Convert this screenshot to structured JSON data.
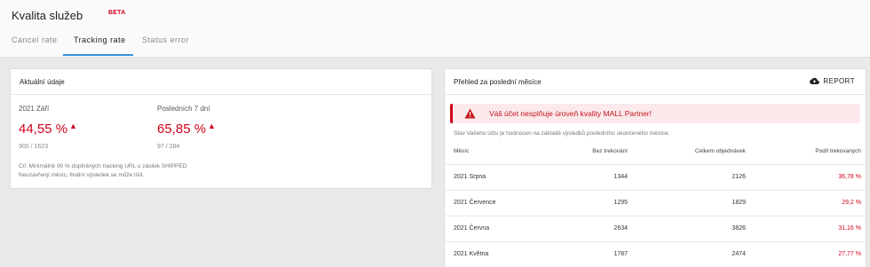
{
  "header": {
    "title": "Kvalita služeb",
    "badge": "BETA",
    "tabs": [
      {
        "label": "Cancel rate"
      },
      {
        "label": "Tracking rate"
      },
      {
        "label": "Status error"
      }
    ]
  },
  "current": {
    "title": "Aktuální údaje",
    "month": {
      "label": "2021 Září",
      "value": "44,55 %",
      "sub": "900 / 1623"
    },
    "week": {
      "label": "Posledních 7 dní",
      "value": "65,85 %",
      "sub": "97 / 284"
    },
    "note1": "Cíl: Minimálně 90 % doplněných tracking URL u zásilek SHIPPED",
    "note2": "Neuzavřený měsíc, finální výsledek se může lišit."
  },
  "overview": {
    "title": "Přehled za poslední měsíce",
    "report_label": "REPORT",
    "alert": "Váš účet nesplňuje úroveň kvality MALL Partner!",
    "status": "Stav Vašeho účtu je hodnocen na základě výsledků posledního ukončeného měsíce.",
    "columns": [
      "Měsíc",
      "Bez trekování",
      "Celkem objednávek",
      "Podíl trekovaných"
    ],
    "rows": [
      {
        "month": "2021 Srpna",
        "without": "1344",
        "total": "2126",
        "share": "36,78 %"
      },
      {
        "month": "2021 Července",
        "without": "1295",
        "total": "1829",
        "share": "29,2 %"
      },
      {
        "month": "2021 Června",
        "without": "2634",
        "total": "3826",
        "share": "31,16 %"
      },
      {
        "month": "2021 Května",
        "without": "1787",
        "total": "2474",
        "share": "27,77 %"
      }
    ]
  },
  "colors": {
    "accent": "#d0021b",
    "tab_active": "#3b8fd9"
  }
}
